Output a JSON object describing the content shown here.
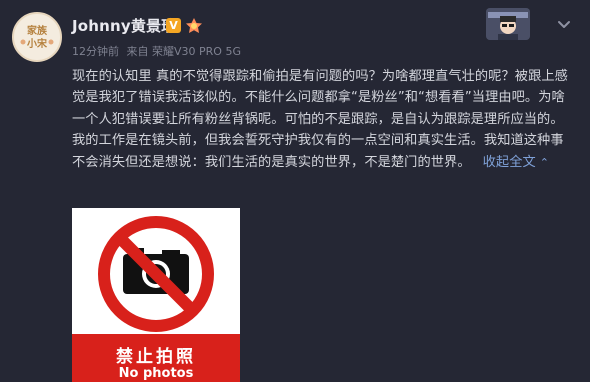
{
  "post": {
    "author": "Johnny黄景瑜",
    "verified_badge": "V",
    "time": "12分钟前",
    "source": "来自 荣耀V30 PRO 5G",
    "content": "现在的认知里 真的不觉得跟踪和偷拍是有问题的吗？为啥都理直气壮的呢？被跟上感觉是我犯了错误我活该似的。不能什么问题都拿“是粉丝”和“想看看”当理由吧。为啥一个人犯错误要让所有粉丝背锅呢。可怕的不是跟踪，是自认为跟踪是理所应当的。我的工作是在镜头前，但我会誓死守护我仅有的一点空间和真实生活。我知道这种事不会消失但还是想说：我们生活的是真实的世界，不是楚门的世界。",
    "collapse_label": "收起全文",
    "collapse_icon": "chevron-up-icon",
    "image": {
      "sign_text_zh": "禁止拍照",
      "sign_text_en": "No photos"
    },
    "avatar_text": [
      "家族",
      "小宋"
    ]
  },
  "colors": {
    "background": "#252734",
    "link": "#7fa1d8",
    "sign_red": "#d8211b",
    "verified": "#f5a623"
  }
}
